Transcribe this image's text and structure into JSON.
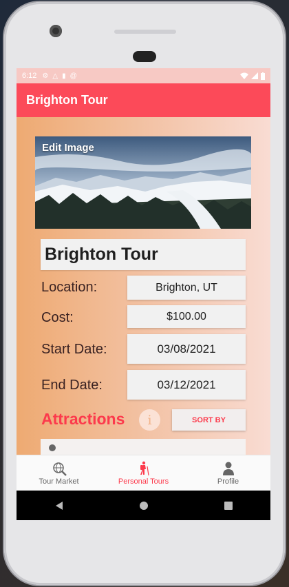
{
  "status_bar": {
    "time": "6:12",
    "left_icons": [
      "gear-icon",
      "drive-icon",
      "sim-icon",
      "at-icon"
    ],
    "right_icons": [
      "wifi-icon",
      "signal-icon",
      "battery-icon"
    ]
  },
  "app_bar": {
    "title": "Brighton Tour",
    "color": "#fc4a59"
  },
  "hero": {
    "edit_label": "Edit Image"
  },
  "tour": {
    "name": "Brighton Tour",
    "location_label": "Location:",
    "location_value": "Brighton, UT",
    "cost_label": "Cost:",
    "cost_value": "$100.00",
    "start_label": "Start Date:",
    "start_value": "03/08/2021",
    "end_label": "End Date:",
    "end_value": "03/12/2021"
  },
  "attractions": {
    "heading": "Attractions",
    "info_label": "i",
    "sort_label": "SORT BY"
  },
  "bottom_nav": {
    "items": [
      {
        "label": "Tour Market",
        "icon": "globe-search-icon",
        "active": false
      },
      {
        "label": "Personal Tours",
        "icon": "hiker-icon",
        "active": true
      },
      {
        "label": "Profile",
        "icon": "person-icon",
        "active": false
      }
    ]
  },
  "colors": {
    "accent": "#fc4a59",
    "accent_text": "#fc3a4c",
    "gradient_start": "#eeaa72",
    "gradient_end": "#f9dcd3"
  }
}
